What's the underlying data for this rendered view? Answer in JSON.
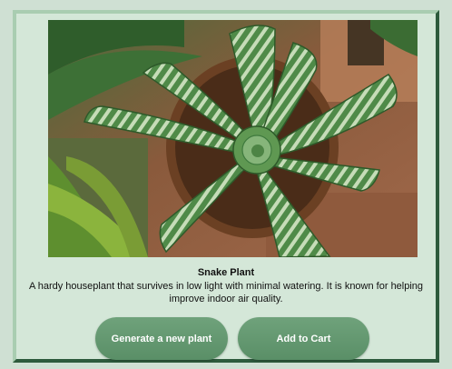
{
  "product": {
    "name": "Snake Plant",
    "description": "A hardy houseplant that survives in low light with minimal watering. It is known for helping improve indoor air quality."
  },
  "actions": {
    "generate_label": "Generate a new plant",
    "cart_label": "Add to Cart"
  },
  "colors": {
    "card_bg": "#d4e7d8",
    "button_bg": "#5f9470",
    "button_text": "#ffffff"
  }
}
